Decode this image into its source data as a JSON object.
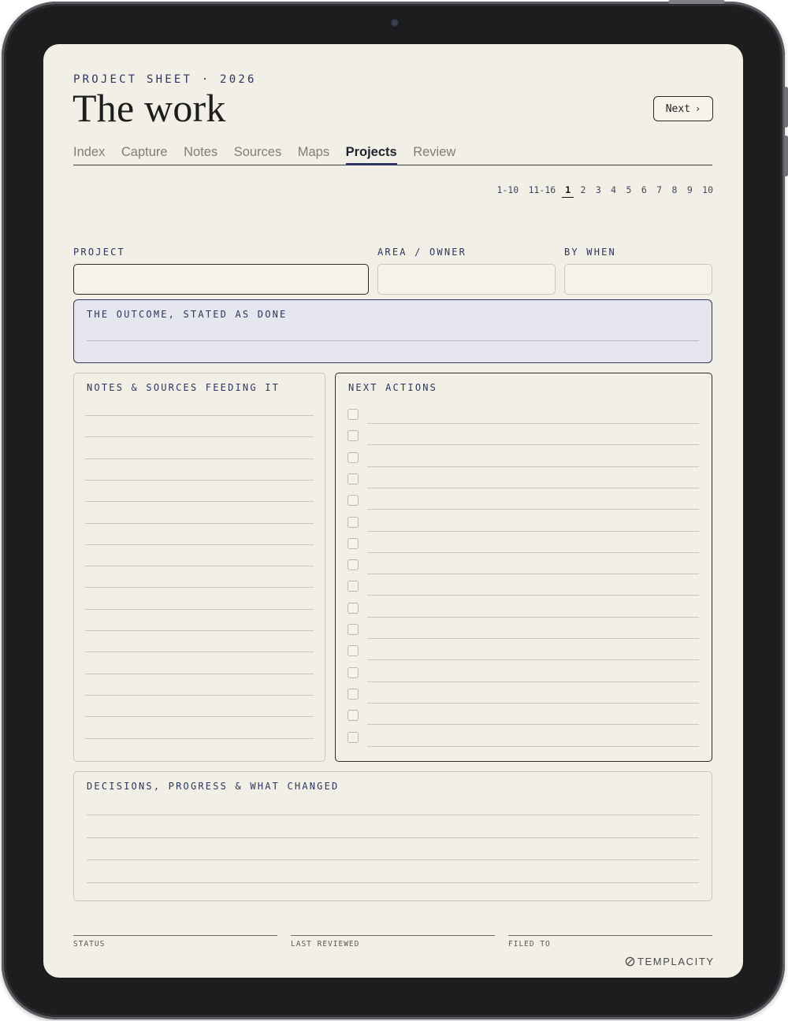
{
  "header": {
    "kicker": "PROJECT SHEET · 2026",
    "title": "The work",
    "next_label": "Next"
  },
  "tabs": [
    {
      "label": "Index"
    },
    {
      "label": "Capture"
    },
    {
      "label": "Notes"
    },
    {
      "label": "Sources"
    },
    {
      "label": "Maps"
    },
    {
      "label": "Projects",
      "active": true
    },
    {
      "label": "Review"
    }
  ],
  "pager": {
    "items": [
      "1-10",
      "11-16",
      "1",
      "2",
      "3",
      "4",
      "5",
      "6",
      "7",
      "8",
      "9",
      "10"
    ],
    "current": "1"
  },
  "fields": {
    "project": "PROJECT",
    "area_owner": "AREA / OWNER",
    "by_when": "BY WHEN"
  },
  "outcome": {
    "label": "THE OUTCOME, STATED AS DONE"
  },
  "notes_panel": {
    "label": "NOTES & SOURCES FEEDING IT",
    "line_count": 16
  },
  "actions_panel": {
    "label": "NEXT ACTIONS",
    "item_count": 16
  },
  "decisions_panel": {
    "label": "DECISIONS, PROGRESS & WHAT CHANGED",
    "line_count": 4
  },
  "footer": {
    "status": "STATUS",
    "last_reviewed": "LAST REVIEWED",
    "filed_to": "FILED TO"
  },
  "brand": {
    "name": "TEMPLACITY"
  },
  "colors": {
    "paper": "#f2efe6",
    "navy_accent": "#2d3561",
    "outcome_fill": "#e6e7ee",
    "device_bezel": "#1c1d1f"
  }
}
